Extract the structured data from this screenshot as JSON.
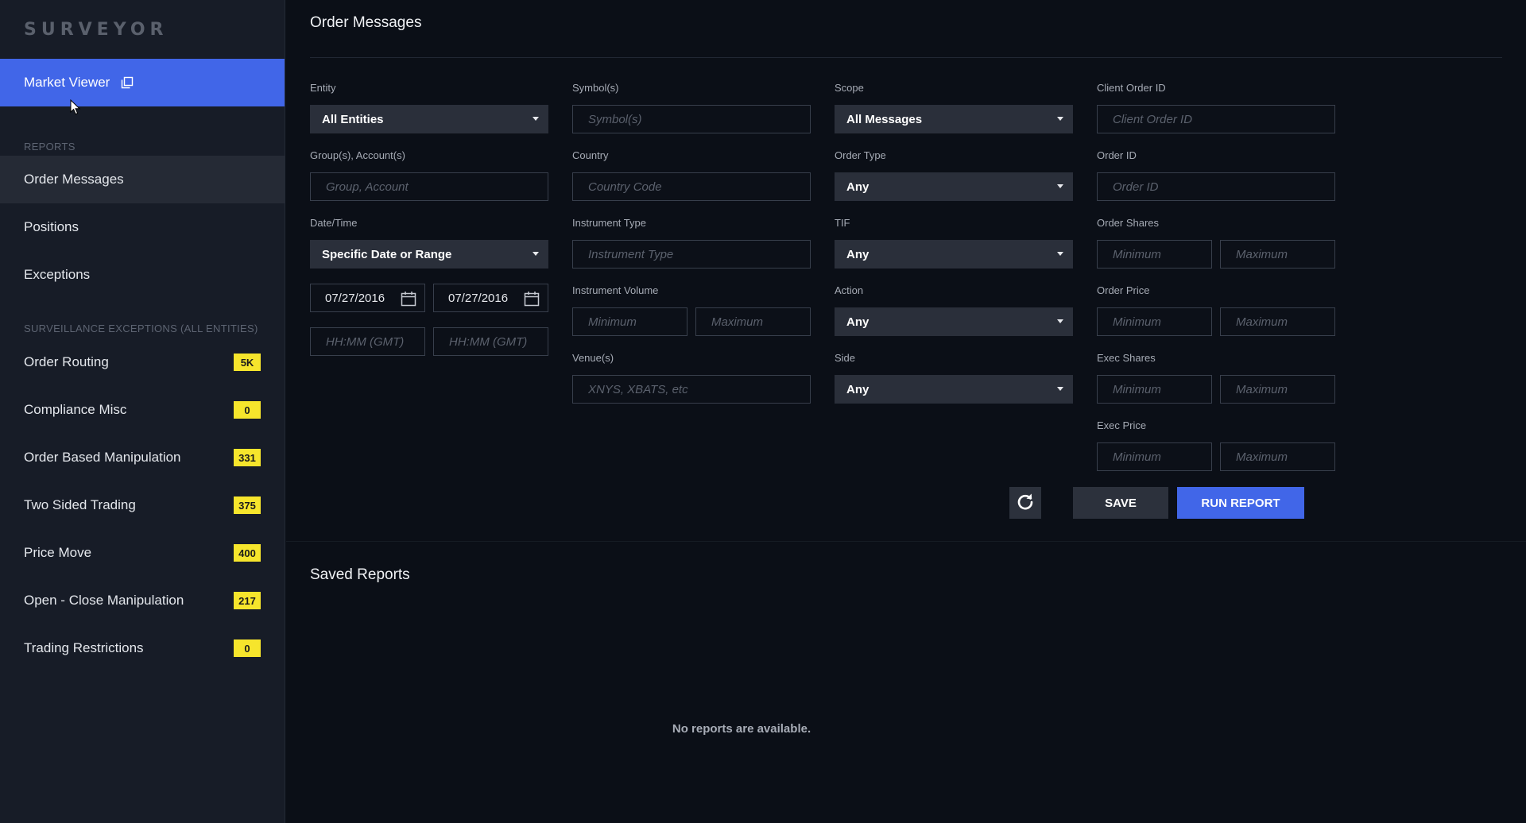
{
  "brand": "SURVEYOR",
  "sidebar": {
    "market_viewer": "Market Viewer",
    "reports_heading": "REPORTS",
    "reports": [
      {
        "label": "Order Messages"
      },
      {
        "label": "Positions"
      },
      {
        "label": "Exceptions"
      }
    ],
    "surveillance_heading": "SURVEILLANCE EXCEPTIONS (All Entities)",
    "exceptions": [
      {
        "label": "Order Routing",
        "count": "5K"
      },
      {
        "label": "Compliance Misc",
        "count": "0"
      },
      {
        "label": "Order Based Manipulation",
        "count": "331"
      },
      {
        "label": "Two Sided Trading",
        "count": "375"
      },
      {
        "label": "Price Move",
        "count": "400"
      },
      {
        "label": "Open - Close Manipulation",
        "count": "217"
      },
      {
        "label": "Trading Restrictions",
        "count": "0"
      }
    ]
  },
  "main": {
    "title": "Order Messages",
    "filters": {
      "entity": {
        "label": "Entity",
        "value": "All Entities"
      },
      "groups": {
        "label": "Group(s), Account(s)",
        "placeholder": "Group, Account"
      },
      "datetime": {
        "label": "Date/Time",
        "value": "Specific Date or Range"
      },
      "date_from": "07/27/2016",
      "date_to": "07/27/2016",
      "time_from_placeholder": "HH:MM (GMT)",
      "time_to_placeholder": "HH:MM (GMT)",
      "symbols": {
        "label": "Symbol(s)",
        "placeholder": "Symbol(s)"
      },
      "country": {
        "label": "Country",
        "placeholder": "Country Code"
      },
      "instrument_type": {
        "label": "Instrument Type",
        "placeholder": "Instrument Type"
      },
      "instrument_volume": {
        "label": "Instrument Volume",
        "min_placeholder": "Minimum",
        "max_placeholder": "Maximum"
      },
      "venues": {
        "label": "Venue(s)",
        "placeholder": "XNYS, XBATS, etc"
      },
      "scope": {
        "label": "Scope",
        "value": "All Messages"
      },
      "order_type": {
        "label": "Order Type",
        "value": "Any"
      },
      "tif": {
        "label": "TIF",
        "value": "Any"
      },
      "action": {
        "label": "Action",
        "value": "Any"
      },
      "side": {
        "label": "Side",
        "value": "Any"
      },
      "client_order_id": {
        "label": "Client Order ID",
        "placeholder": "Client Order ID"
      },
      "order_id": {
        "label": "Order ID",
        "placeholder": "Order ID"
      },
      "order_shares": {
        "label": "Order Shares",
        "min_placeholder": "Minimum",
        "max_placeholder": "Maximum"
      },
      "order_price": {
        "label": "Order Price",
        "min_placeholder": "Minimum",
        "max_placeholder": "Maximum"
      },
      "exec_shares": {
        "label": "Exec Shares",
        "min_placeholder": "Minimum",
        "max_placeholder": "Maximum"
      },
      "exec_price": {
        "label": "Exec Price",
        "min_placeholder": "Minimum",
        "max_placeholder": "Maximum"
      }
    },
    "buttons": {
      "save": "SAVE",
      "run": "RUN REPORT"
    },
    "saved_reports": {
      "title": "Saved Reports",
      "empty": "No reports are available."
    }
  },
  "colors": {
    "accent": "#4166e8",
    "badge": "#f6e52c",
    "sidebar_bg": "#171c27",
    "main_bg": "#0b0f17"
  },
  "icons": {
    "market_viewer": "popout-window-icon",
    "calendar": "calendar-icon",
    "refresh": "refresh-icon",
    "dropdown": "caret-down-icon",
    "pointer": "mouse-cursor-icon"
  }
}
